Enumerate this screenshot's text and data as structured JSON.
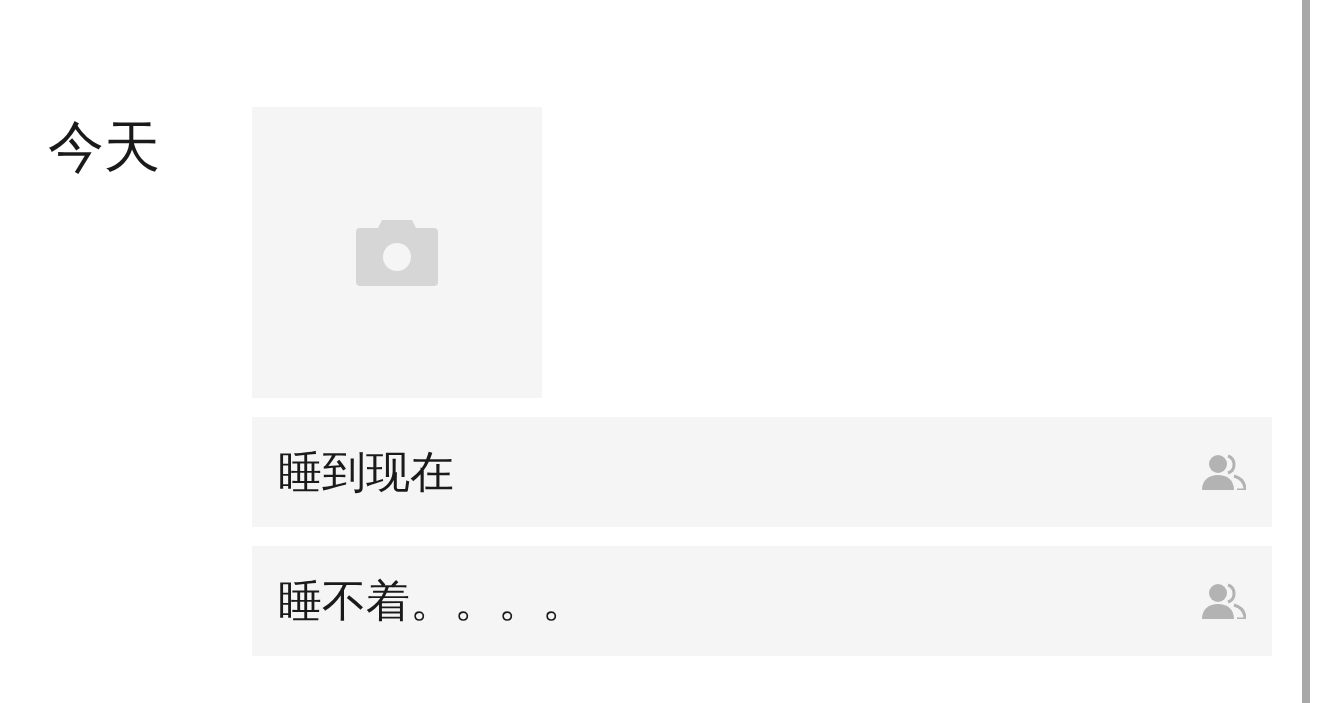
{
  "day_label": "今天",
  "posts": [
    {
      "kind": "photo"
    },
    {
      "kind": "text",
      "text": "睡到现在"
    },
    {
      "kind": "text",
      "text": "睡不着。。。。"
    }
  ]
}
